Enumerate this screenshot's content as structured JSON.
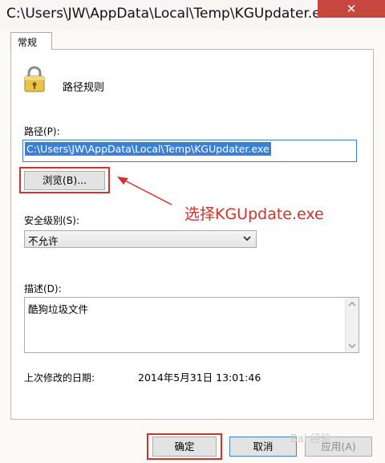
{
  "window": {
    "title": "C:\\Users\\JW\\AppData\\Local\\Temp\\KGUpdater.exe ...",
    "close_glyph": "✕"
  },
  "tabs": [
    {
      "label": "常规"
    }
  ],
  "rule": {
    "label": "路径规则"
  },
  "path": {
    "label": "路径(P):",
    "value": "C:\\Users\\JW\\AppData\\Local\\Temp\\KGUpdater.exe",
    "browse_label": "浏览(B)..."
  },
  "annotation": {
    "text": "选择KGUpdate.exe"
  },
  "security": {
    "label": "安全级别(S):",
    "selected": "不允许"
  },
  "description": {
    "label": "描述(D):",
    "value": "酷狗垃圾文件"
  },
  "modified": {
    "label": "上次修改的日期:",
    "value": "2014年5月31日   13:01:46"
  },
  "buttons": {
    "ok": "确定",
    "cancel": "取消",
    "apply": "应用(A)"
  },
  "watermark": {
    "text": "Bai 经验"
  },
  "colors": {
    "annotation_red": "#d3312b",
    "selection_blue": "#3d7fd1",
    "close_red": "#c7463f"
  }
}
